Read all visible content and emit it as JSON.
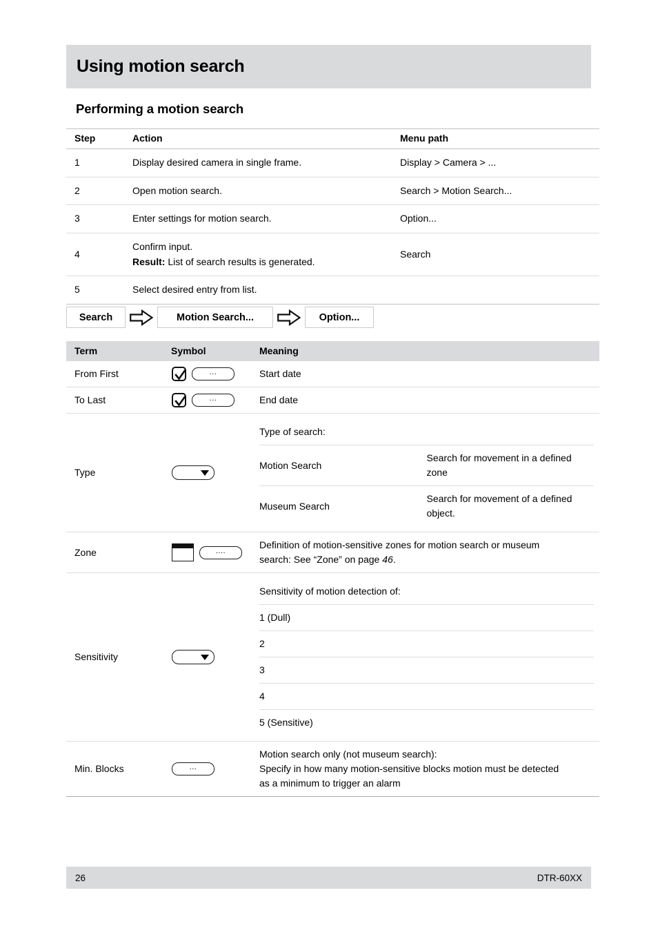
{
  "document": {
    "title": "Using motion search",
    "section_heading": "Performing a motion search"
  },
  "steps_table": {
    "headers": {
      "step": "Step",
      "action": "Action",
      "menu_path": "Menu path"
    },
    "rows": [
      {
        "step": "1",
        "action": "Display desired camera in single frame.",
        "menu_path": "Display > Camera > ..."
      },
      {
        "step": "2",
        "action": "Open motion search.",
        "menu_path": "Search > Motion Search..."
      },
      {
        "step": "3",
        "action": "Enter settings for motion search.",
        "menu_path": "Option..."
      },
      {
        "step": "4",
        "action": "Confirm input.",
        "action_result_label": "Result:",
        "action_result_text": " List of search results is generated.",
        "menu_path": "Search"
      },
      {
        "step": "5",
        "action": "Select desired entry from list.",
        "menu_path": ""
      }
    ]
  },
  "breadcrumb": {
    "items": [
      "Search",
      "Motion Search...",
      "Option..."
    ],
    "separator_icon": "arrow-right-icon"
  },
  "symbol_table": {
    "headers": {
      "term": "Term",
      "symbol": "Symbol",
      "meaning": "Meaning"
    },
    "rows": [
      {
        "term": "From First",
        "symbols": [
          "checkbox-checked-icon",
          "ellipsis-button-icon"
        ],
        "dots_label": "...",
        "meaning": "Start date"
      },
      {
        "term": "To Last",
        "symbols": [
          "checkbox-checked-icon",
          "ellipsis-button-icon"
        ],
        "dots_label": "...",
        "meaning": "End date"
      },
      {
        "term": "Type",
        "symbols": [
          "dropdown-select-icon"
        ],
        "meaning_intro": "Type of search:",
        "sub_rows": [
          {
            "name": "Motion Search",
            "text": "Search for movement in a defined zone"
          },
          {
            "name": "Museum Search",
            "text": "Search for movement of a defined object."
          }
        ]
      },
      {
        "term": "Zone",
        "symbols": [
          "zone-window-icon",
          "ellipsis-button-icon"
        ],
        "dots_label": "....",
        "meaning_line1": "Definition of motion-sensitive zones for motion search or museum",
        "meaning_line2_a": "search: See “Zone” on page ",
        "meaning_line2_page": "46",
        "meaning_line2_b": "."
      },
      {
        "term": "Sensitivity",
        "symbols": [
          "dropdown-select-icon"
        ],
        "meaning_intro": "Sensitivity of motion detection of:",
        "sub_rows": [
          {
            "name": "1 (Dull)"
          },
          {
            "name": "2"
          },
          {
            "name": "3"
          },
          {
            "name": "4"
          },
          {
            "name": "5 (Sensitive)"
          }
        ]
      },
      {
        "term": "Min. Blocks",
        "symbols": [
          "ellipsis-button-icon"
        ],
        "dots_label": "...",
        "meaning_line1": "Motion search only (not museum search):",
        "meaning_line2": "Specify in how many motion-sensitive blocks motion must be detected",
        "meaning_line3": "as a minimum to trigger an alarm"
      }
    ]
  },
  "footer": {
    "page_number": "26",
    "model": "DTR-60XX"
  },
  "colors": {
    "header_band": "#d8dadc",
    "rule_major": "#c4c6c8",
    "rule_minor": "#dcdddf",
    "text": "#000000"
  }
}
